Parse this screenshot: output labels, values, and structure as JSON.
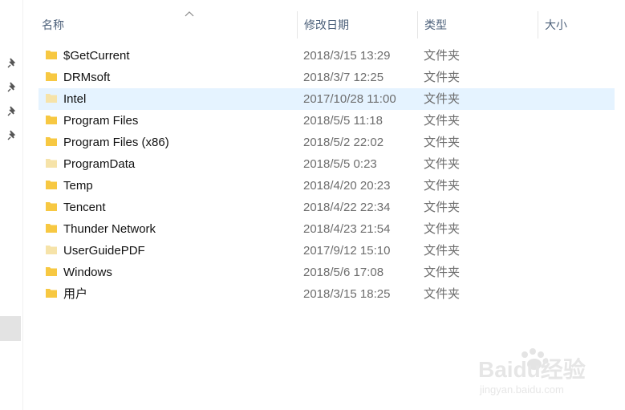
{
  "columns": {
    "name": "名称",
    "date": "修改日期",
    "type": "类型",
    "size": "大小"
  },
  "files": [
    {
      "name": "$GetCurrent",
      "date": "2018/3/15 13:29",
      "type": "文件夹",
      "faded": false
    },
    {
      "name": "DRMsoft",
      "date": "2018/3/7 12:25",
      "type": "文件夹",
      "faded": false
    },
    {
      "name": "Intel",
      "date": "2017/10/28 11:00",
      "type": "文件夹",
      "faded": true,
      "selected": true
    },
    {
      "name": "Program Files",
      "date": "2018/5/5 11:18",
      "type": "文件夹",
      "faded": false
    },
    {
      "name": "Program Files (x86)",
      "date": "2018/5/2 22:02",
      "type": "文件夹",
      "faded": false
    },
    {
      "name": "ProgramData",
      "date": "2018/5/5 0:23",
      "type": "文件夹",
      "faded": true
    },
    {
      "name": "Temp",
      "date": "2018/4/20 20:23",
      "type": "文件夹",
      "faded": false
    },
    {
      "name": "Tencent",
      "date": "2018/4/22 22:34",
      "type": "文件夹",
      "faded": false
    },
    {
      "name": "Thunder Network",
      "date": "2018/4/23 21:54",
      "type": "文件夹",
      "faded": false
    },
    {
      "name": "UserGuidePDF",
      "date": "2017/9/12 15:10",
      "type": "文件夹",
      "faded": true
    },
    {
      "name": "Windows",
      "date": "2018/5/6 17:08",
      "type": "文件夹",
      "faded": false
    },
    {
      "name": "用户",
      "date": "2018/3/15 18:25",
      "type": "文件夹",
      "faded": false
    }
  ],
  "watermark": {
    "brand": "Baidu经验",
    "url": "jingyan.baidu.com"
  },
  "icons": {
    "folder": "folder-icon",
    "pin": "pin-icon",
    "sort": "sort-ascending-icon"
  },
  "colors": {
    "folder": "#f7c842",
    "folder_faded": "#f6e3a9",
    "selected_row": "#e5f3ff",
    "header_text": "#4c607a"
  }
}
